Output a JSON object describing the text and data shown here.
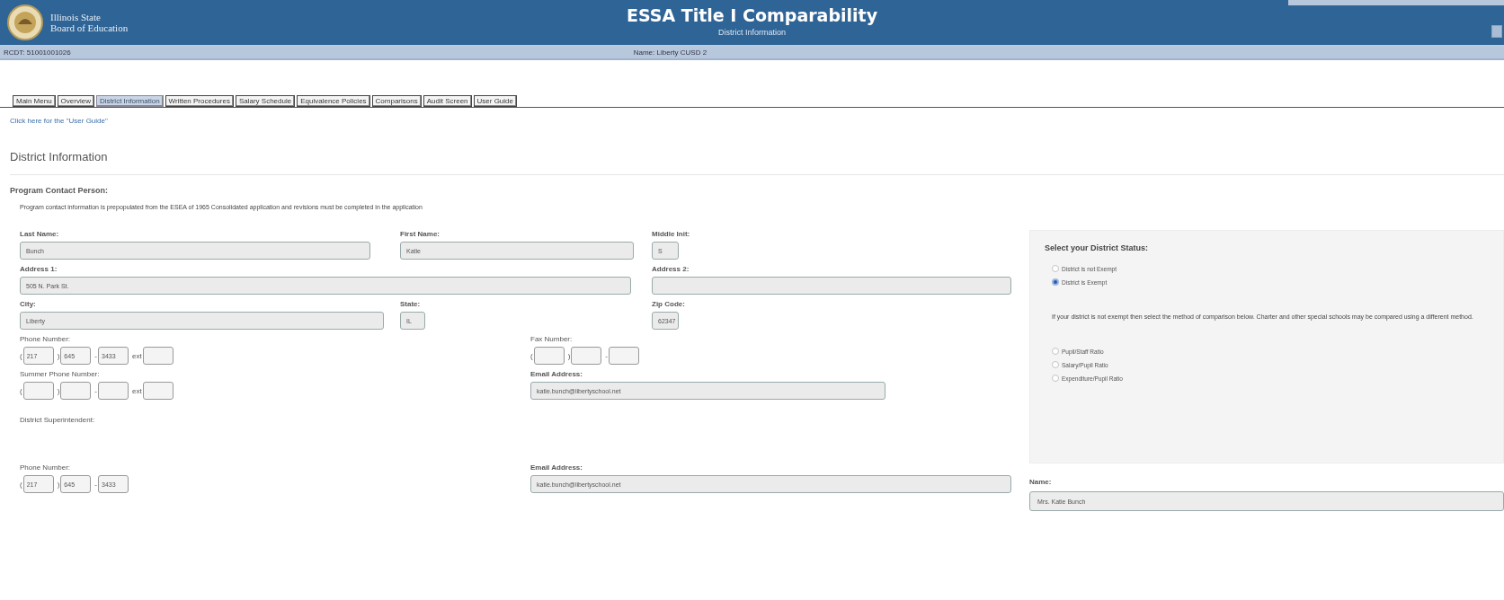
{
  "header": {
    "org_line_1": "Illinois State",
    "org_line_2": "Board of Education",
    "title": "ESSA Title I Comparability",
    "subtitle": "District Information"
  },
  "info_bar": {
    "rcdt": "RCDT: 51001001026",
    "name": "Name: Liberty CUSD 2"
  },
  "tabs": [
    {
      "label": "Main Menu",
      "selected": false
    },
    {
      "label": "Overview",
      "selected": false
    },
    {
      "label": "District Information",
      "selected": true
    },
    {
      "label": "Written Procedures",
      "selected": false
    },
    {
      "label": "Salary Schedule",
      "selected": false
    },
    {
      "label": "Equivalence Policies",
      "selected": false
    },
    {
      "label": "Comparisons",
      "selected": false
    },
    {
      "label": "Audit Screen",
      "selected": false
    },
    {
      "label": "User Guide",
      "selected": false
    }
  ],
  "guide_link": "Click here for the \"User Guide\"",
  "page_heading": "District Information",
  "contact": {
    "heading": "Program Contact Person:",
    "note": "Program contact information is prepopulated from the ESEA of 1965 Consolidated application and revisions must be completed in the application",
    "fields": [
      {
        "kind": "text",
        "label": "Last Name:",
        "value": "Bunch"
      },
      {
        "kind": "text",
        "label": "First Name:",
        "value": "Katie"
      },
      {
        "kind": "text",
        "label": "Middle Init:",
        "value": "S"
      },
      {
        "kind": "text",
        "label": "Address 1:",
        "value": "505 N. Park St."
      },
      {
        "kind": "text",
        "label": "Address 2:"
      },
      {
        "kind": "text",
        "label": "City:",
        "value": "Liberty"
      },
      {
        "kind": "text",
        "label": "State:",
        "value": "IL"
      },
      {
        "kind": "text",
        "label": "Zip Code:",
        "value": "62347"
      },
      {
        "kind": "phone",
        "label": "Phone Number:",
        "parts": [
          {
            "sep": "(",
            "value": "217"
          },
          {
            "sep": ")",
            "value": "645"
          },
          {
            "sep": "-",
            "value": "3433"
          },
          {
            "sep": "ext"
          }
        ]
      },
      {
        "kind": "phone",
        "label": "Fax Number:",
        "parts": [
          {
            "sep": "("
          },
          {
            "sep": ")"
          },
          {
            "sep": "-"
          }
        ]
      },
      {
        "kind": "phone",
        "label": "Summer Phone Number:",
        "parts": [
          {
            "sep": "("
          },
          {
            "sep": ")"
          },
          {
            "sep": "-"
          },
          {
            "sep": "ext"
          }
        ]
      },
      {
        "kind": "text",
        "label": "Email Address:",
        "value": "katie.bunch@libertyschool.net"
      }
    ]
  },
  "superintendent": {
    "heading": "District Superintendent:",
    "fields": [
      {
        "kind": "phone",
        "label": "Phone Number:",
        "parts": [
          {
            "sep": "(",
            "value": "217"
          },
          {
            "sep": ")",
            "value": "645"
          },
          {
            "sep": "-",
            "value": "3433"
          }
        ]
      },
      {
        "kind": "text",
        "label": "Email Address:",
        "value": "katie.bunch@libertyschool.net"
      }
    ],
    "name_label": "Name:",
    "name_value": "Mrs. Katie Bunch"
  },
  "status_panel": {
    "heading": "Select your District Status:",
    "status_options": [
      {
        "label": "District is not Exempt",
        "selected": false
      },
      {
        "label": "District is Exempt",
        "selected": true
      }
    ],
    "note": "If your district is not exempt then select the method of comparison below. Charter and other special schools may be compared using a different method.",
    "method_options": [
      {
        "label": "Pupil/Staff Ratio",
        "selected": false
      },
      {
        "label": "Salary/Pupil Ratio",
        "selected": false
      },
      {
        "label": "Expenditure/Pupil Ratio",
        "selected": false
      }
    ]
  }
}
